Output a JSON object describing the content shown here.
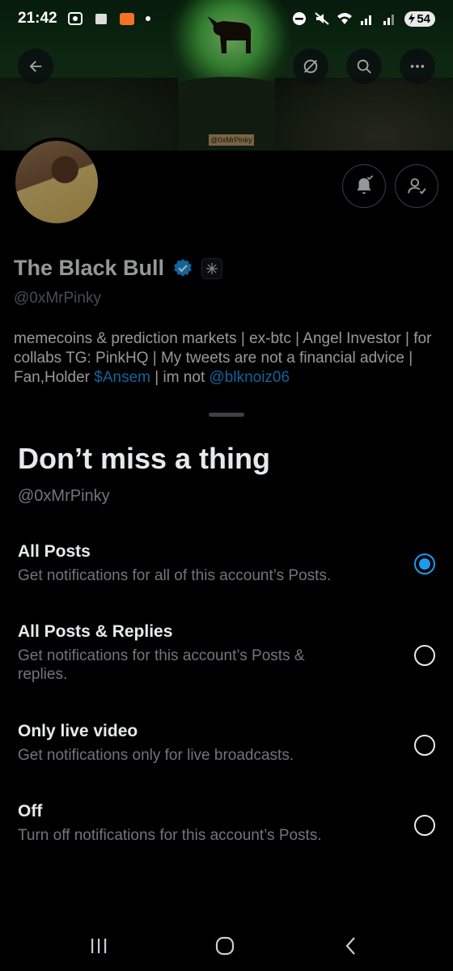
{
  "status_bar": {
    "time": "21:42",
    "battery": "54"
  },
  "banner": {
    "watermark": "@0xMrPinky"
  },
  "profile": {
    "name": "The Black Bull",
    "handle": "@0xMrPinky",
    "bio_text": "memecoins & prediction markets | ex-btc | Angel Investor | for collabs TG: PinkHQ | My tweets are not a financial advice | Fan,Holder ",
    "bio_cashtag": "$Ansem",
    "bio_mid": " | im not ",
    "bio_mention": "@blknoiz06"
  },
  "sheet": {
    "title": "Don’t miss a thing",
    "handle": "@0xMrPinky",
    "options": [
      {
        "title": "All Posts",
        "desc": "Get notifications for all of this account’s Posts.",
        "selected": true
      },
      {
        "title": "All Posts & Replies",
        "desc": "Get notifications for this account’s Posts & replies.",
        "selected": false
      },
      {
        "title": "Only live video",
        "desc": "Get notifications only for live broadcasts.",
        "selected": false
      },
      {
        "title": "Off",
        "desc": "Turn off notifications for this account’s Posts.",
        "selected": false
      }
    ]
  },
  "colors": {
    "accent": "#1d9bf0",
    "background": "#000000",
    "text_primary": "#e7e9ea",
    "text_secondary": "#71767b"
  },
  "icons": {
    "back": "arrow-left-icon",
    "grok": "grok-icon",
    "search": "search-icon",
    "more": "more-icon",
    "notifications": "bell-check-icon",
    "following": "person-check-icon",
    "verified": "verified-badge-icon",
    "affiliate": "affiliate-badge-icon"
  }
}
